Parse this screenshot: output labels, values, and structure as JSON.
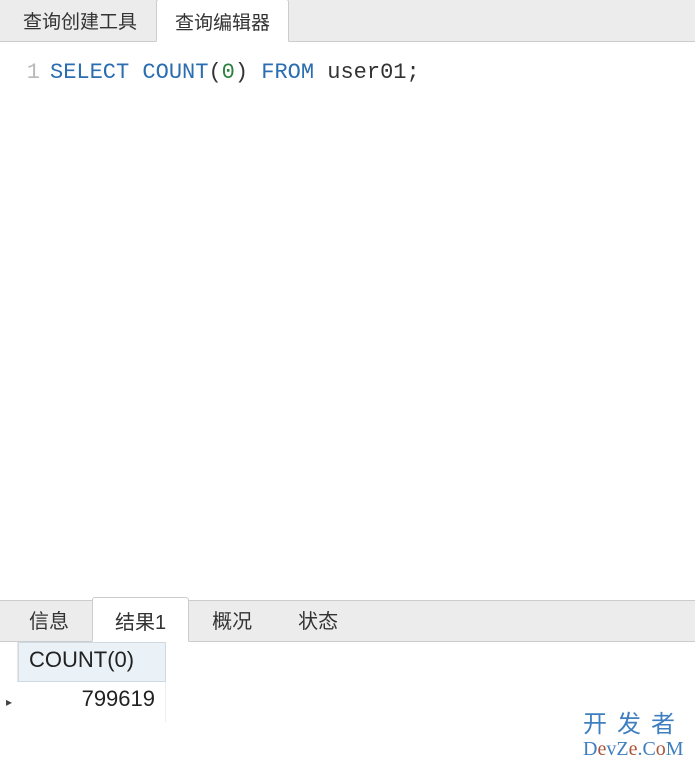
{
  "topTabs": {
    "builder": "查询创建工具",
    "editor": "查询编辑器"
  },
  "editor": {
    "lineNumber": "1",
    "tokens": {
      "select": "SELECT",
      "count": "COUNT",
      "lp": "(",
      "zero": "0",
      "rp": ")",
      "from": "FROM",
      "table": "user01",
      "semi": ";"
    },
    "raw": "SELECT COUNT(0) FROM user01;"
  },
  "resultTabs": {
    "info": "信息",
    "result1": "结果1",
    "profile": "概况",
    "status": "状态"
  },
  "resultGrid": {
    "columns": [
      "COUNT(0)"
    ],
    "rows": [
      {
        "marker": "▸",
        "cells": [
          "799619"
        ]
      }
    ]
  },
  "watermark": {
    "line1": "开发者",
    "line2_plain1": "D",
    "line2_alt1": "e",
    "line2_plain2": "vZ",
    "line2_alt2": "e",
    "line2_plain3": ".C",
    "line2_alt3": "o",
    "line2_plain4": "M"
  }
}
